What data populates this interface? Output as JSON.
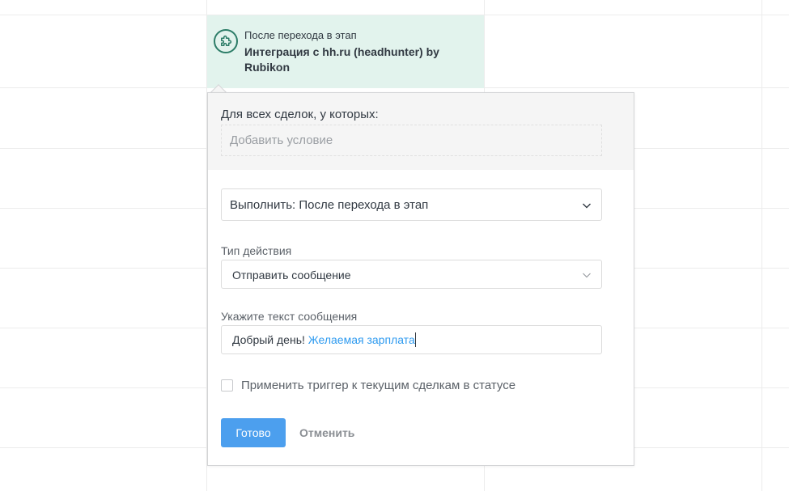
{
  "trigger": {
    "subtitle": "После перехода в этап",
    "title": "Интеграция с hh.ru (headhunter) by Rubikon",
    "icon": "puzzle-icon"
  },
  "popup": {
    "conditions_label": "Для всех сделок, у которых:",
    "add_condition_placeholder": "Добавить условие",
    "execute_value": "Выполнить: После перехода в этап",
    "action_type_label": "Тип действия",
    "action_type_value": "Отправить сообщение",
    "message_label": "Укажите текст сообщения",
    "message_text": "Добрый день! ",
    "message_variable": "Желаемая зарплата",
    "apply_checkbox_label": "Применить триггер к текущим сделкам в статусе",
    "apply_checked": false,
    "done_label": "Готово",
    "cancel_label": "Отменить"
  },
  "colors": {
    "accent": "#4c9fee",
    "variable": "#2f9bf0",
    "trigger_bg": "#e2f3ed",
    "trigger_icon": "#2d7d68"
  }
}
